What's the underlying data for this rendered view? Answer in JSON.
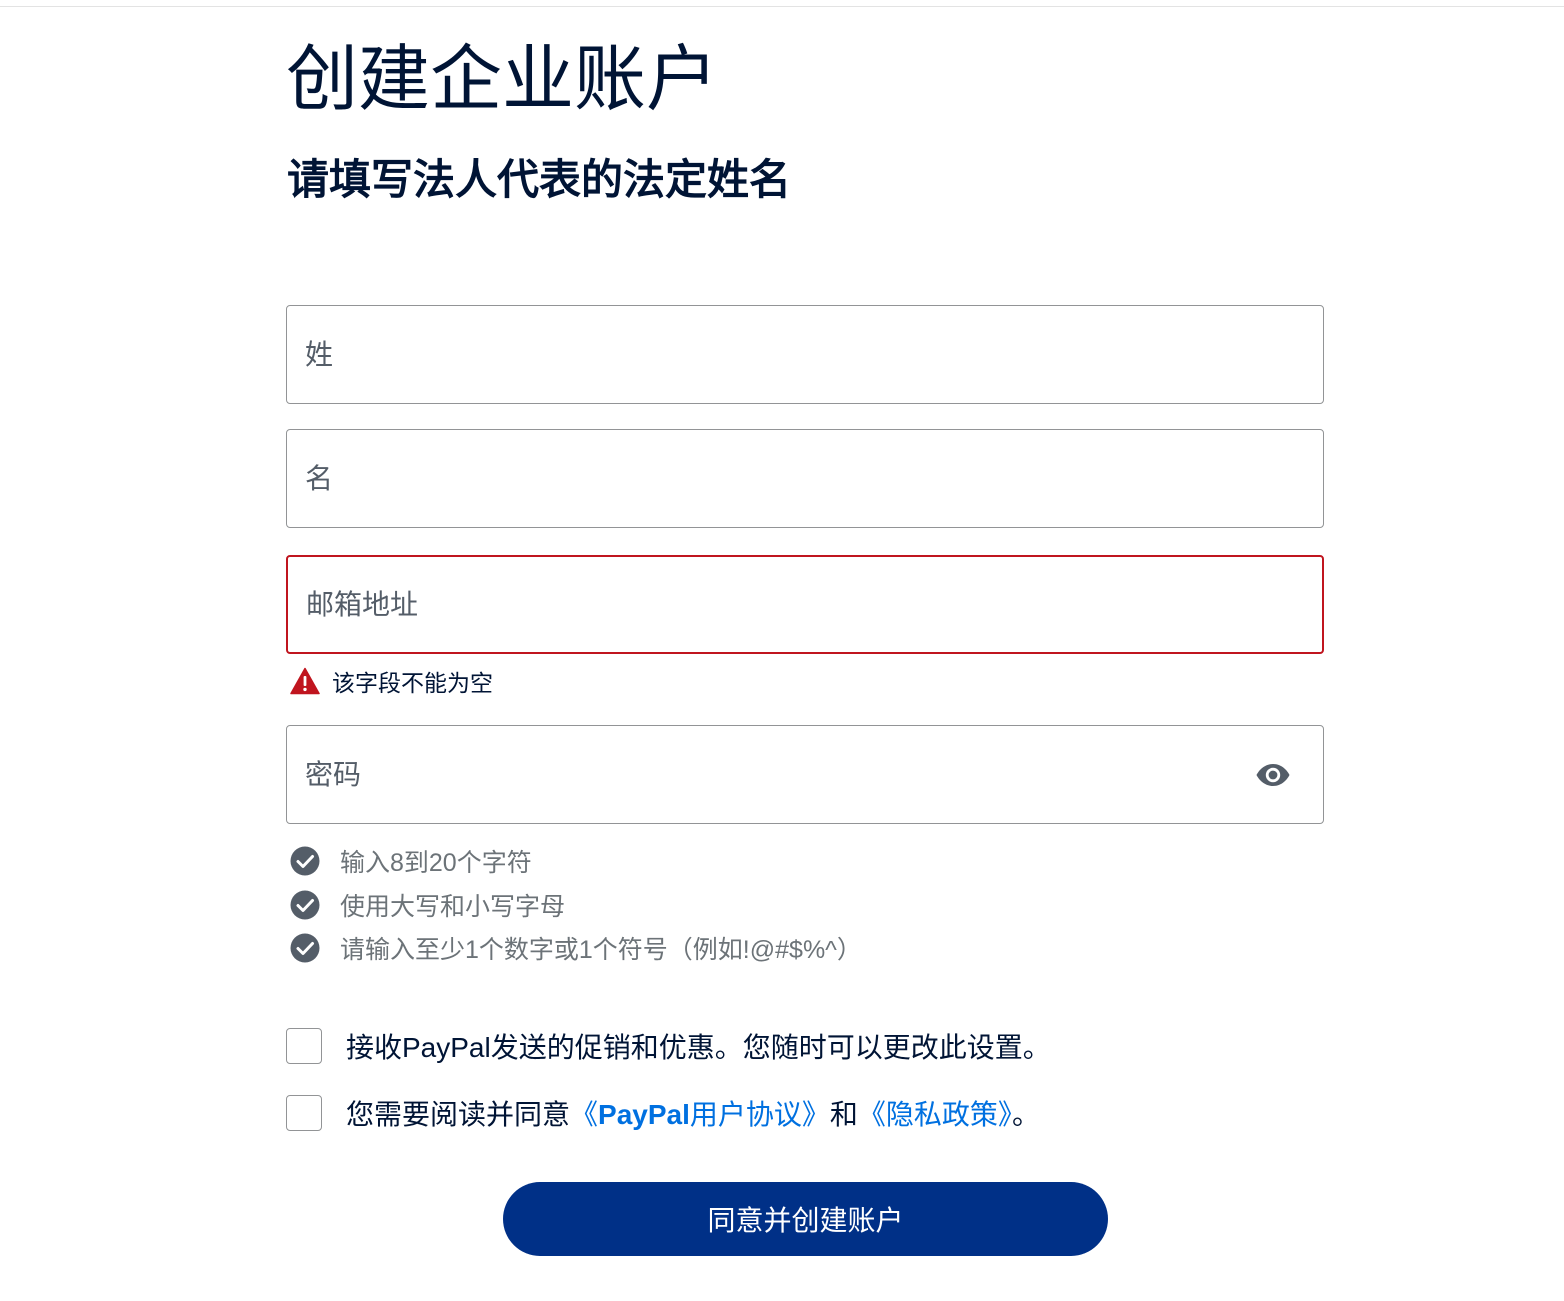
{
  "header": {
    "title": "创建企业账户",
    "subtitle": "请填写法人代表的法定姓名"
  },
  "form": {
    "last_name": {
      "placeholder": "姓",
      "value": ""
    },
    "first_name": {
      "placeholder": "名",
      "value": ""
    },
    "email": {
      "placeholder": "邮箱地址",
      "value": "",
      "error": "该字段不能为空"
    },
    "password": {
      "placeholder": "密码",
      "value": "",
      "toggle_icon": "eye-icon",
      "rules": [
        "输入8到20个字符",
        "使用大写和小写字母",
        "请输入至少1个数字或1个符号（例如!@#$%^）"
      ]
    }
  },
  "consents": {
    "promo": {
      "label": "接收PayPal发送的促销和优惠。您随时可以更改此设置。",
      "checked": false
    },
    "agreement": {
      "prefix": "您需要阅读并同意",
      "link1_open": "《",
      "link1_bold": "PayPal",
      "link1_rest": "用户协议》",
      "middle": "和",
      "link2": "《隐私政策》",
      "suffix": "。",
      "checked": false
    }
  },
  "submit_label": "同意并创建账户",
  "colors": {
    "title": "#001435",
    "error": "#c0151f",
    "link": "#0070e0",
    "primary_button": "#003087",
    "rule_check": "#545d68"
  }
}
